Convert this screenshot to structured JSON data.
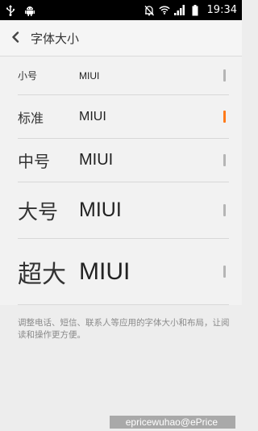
{
  "status_bar": {
    "time": "19:34",
    "icons": [
      "usb-icon",
      "android-debug-icon",
      "alarm-off-icon",
      "wifi-icon",
      "signal-icon",
      "battery-icon"
    ]
  },
  "header": {
    "back_icon": "back-arrow-icon",
    "title": "字体大小"
  },
  "font_sizes": {
    "selected": "标准",
    "items": [
      {
        "label": "小号",
        "sample": "MIUI"
      },
      {
        "label": "标准",
        "sample": "MIUI"
      },
      {
        "label": "中号",
        "sample": "MIUI"
      },
      {
        "label": "大号",
        "sample": "MIUI"
      },
      {
        "label": "超大",
        "sample": "MIUI"
      }
    ]
  },
  "description": "调整电话、短信、联系人等应用的字体大小和布局，让阅读和操作更方便。",
  "watermark": "epricewuhao@ePrice",
  "colors": {
    "accent": "#ff7a1a",
    "status_bar_bg": "#000000"
  }
}
